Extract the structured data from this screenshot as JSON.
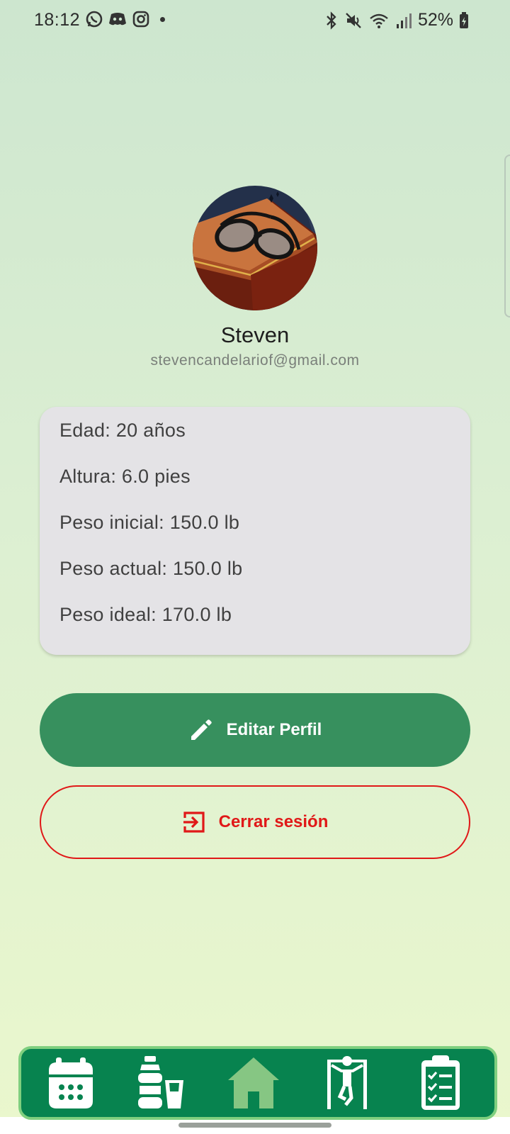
{
  "status_bar": {
    "time": "18:12",
    "notification_icons": [
      "whatsapp-icon",
      "discord-icon",
      "instagram-icon"
    ],
    "status_icons": [
      "bluetooth-icon",
      "mute-icon",
      "wifi-icon",
      "signal-icon"
    ],
    "battery_percent": "52%"
  },
  "profile": {
    "name": "Steven",
    "email": "stevencandelariof@gmail.com"
  },
  "info": {
    "age": "Edad: 20 años",
    "height": "Altura: 6.0 pies",
    "initial_weight": "Peso inicial: 150.0 lb",
    "current_weight": "Peso actual: 150.0 lb",
    "ideal_weight": "Peso ideal: 170.0 lb"
  },
  "actions": {
    "edit_label": "Editar Perfil",
    "logout_label": "Cerrar sesión"
  },
  "bottom_nav": {
    "items": [
      "calendar-icon",
      "water-bottle-icon",
      "home-icon",
      "exercise-icon",
      "checklist-icon"
    ],
    "active": "home-icon"
  },
  "colors": {
    "primary": "#37905e",
    "nav_background": "#07834f",
    "nav_active": "#86c683",
    "danger": "#e01818",
    "card": "#e4e3e6"
  }
}
